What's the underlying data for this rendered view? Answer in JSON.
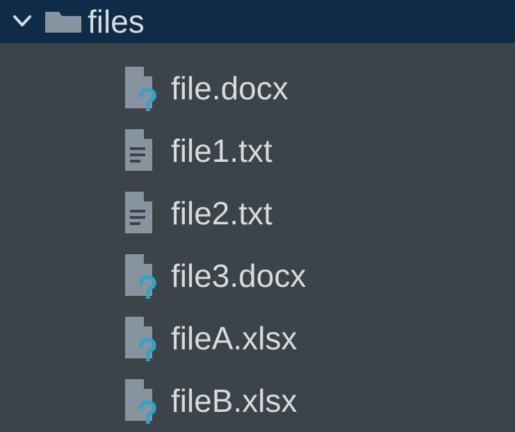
{
  "colors": {
    "bg": "#3c4349",
    "selected_bg": "#0e2b47",
    "text": "#d8dbdd",
    "icon": "#8893a0",
    "accent": "#2ea5c6"
  },
  "tree": {
    "expanded": true,
    "folder_label": "files",
    "children": [
      {
        "name": "file.docx",
        "icon": "unknown"
      },
      {
        "name": "file1.txt",
        "icon": "text"
      },
      {
        "name": "file2.txt",
        "icon": "text"
      },
      {
        "name": "file3.docx",
        "icon": "unknown"
      },
      {
        "name": "fileA.xlsx",
        "icon": "unknown"
      },
      {
        "name": "fileB.xlsx",
        "icon": "unknown"
      }
    ]
  }
}
